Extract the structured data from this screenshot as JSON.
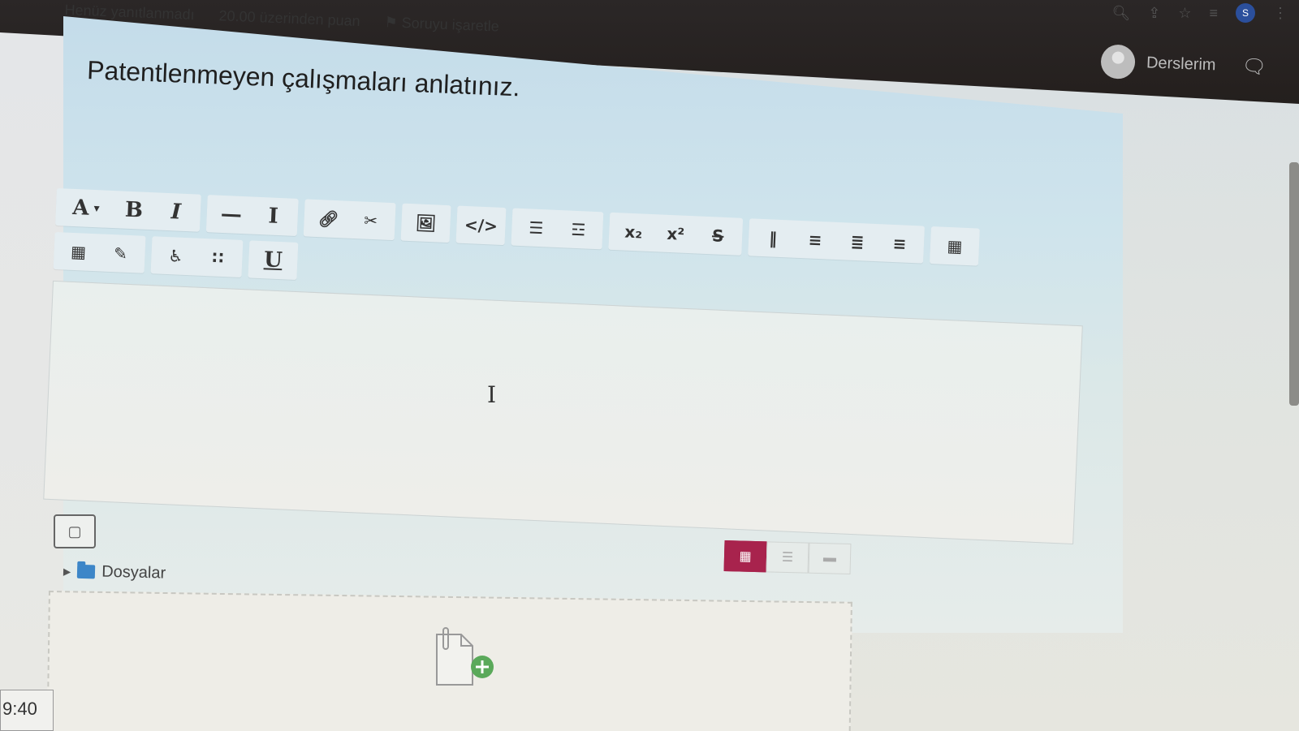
{
  "browser": {
    "icons": [
      "zoom-icon",
      "share-icon",
      "star-icon",
      "reading-list-icon",
      "profile-icon",
      "menu-icon"
    ],
    "profile_initial": "S"
  },
  "navbar": {
    "user_menu_label": "Derslerim"
  },
  "question": {
    "status": "Henüz yanıtlanmadı",
    "points": "20.00 üzerinden puan",
    "flag_label": "Soruyu işaretle",
    "text": "Patentlenmeyen çalışmaları anlatınız."
  },
  "toolbar": {
    "groups": [
      [
        "font-style",
        "bold",
        "italic"
      ],
      [
        "horizontal-rule",
        "clear-formatting"
      ],
      [
        "link",
        "unlink"
      ],
      [
        "image"
      ],
      [
        "html-source"
      ],
      [
        "bullet-list",
        "numbered-list"
      ],
      [
        "subscript",
        "superscript",
        "strikethrough"
      ],
      [
        "rtl",
        "align-left",
        "align-center",
        "align-right"
      ],
      [
        "table"
      ],
      [
        "equation",
        "edit"
      ],
      [
        "accessibility-checker",
        "screen-reader-helper"
      ],
      [
        "underline"
      ]
    ]
  },
  "files": {
    "label": "Dosyalar",
    "view_modes": [
      "icons-view",
      "list-view",
      "tree-view"
    ],
    "active_view": "icons-view"
  },
  "clock": {
    "time": "9:40"
  }
}
